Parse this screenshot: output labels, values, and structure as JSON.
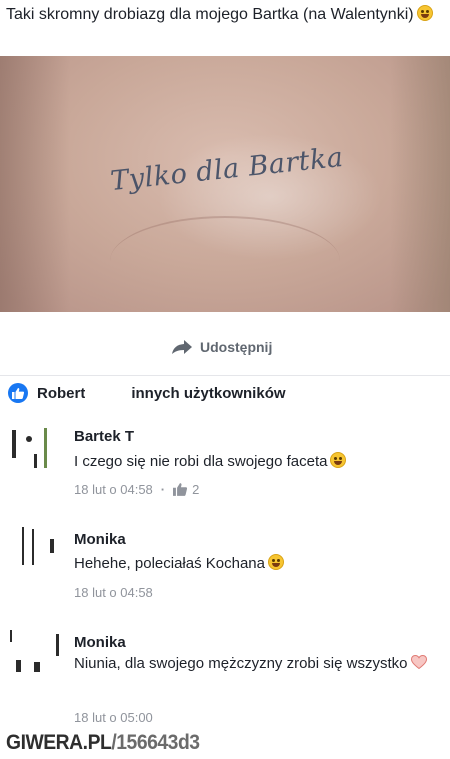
{
  "post": {
    "text": "Taki skromny drobiazg dla mojego Bartka (na Walentynki)",
    "emoji": "smile-emoji",
    "photo_tattoo_text": "Tylko dla Bartka"
  },
  "actions": {
    "share_label": "Udostępnij",
    "share_icon": "share-arrow-icon"
  },
  "reactions": {
    "name_start": "Robert",
    "suffix": "innych użytkowników",
    "icon": "like-icon",
    "color": "#1877f2"
  },
  "comments": [
    {
      "name": "Bartek T",
      "text": "I czego się nie robi dla swojego faceta",
      "emoji": "grin-emoji",
      "date": "18 lut o 04:58",
      "likes": "2"
    },
    {
      "name": "Monika",
      "text": "Hehehe, poleciałaś Kochana",
      "emoji": "smile-emoji",
      "date": "18 lut o 04:58"
    },
    {
      "name": "Monika",
      "text": "Niunia, dla swojego mężczyzny zrobi się wszystko",
      "emoji": "heart-emoji",
      "date": "18 lut o 05:00"
    }
  ],
  "watermark": {
    "site": "GIWERA.PL",
    "id": "/156643d3"
  }
}
